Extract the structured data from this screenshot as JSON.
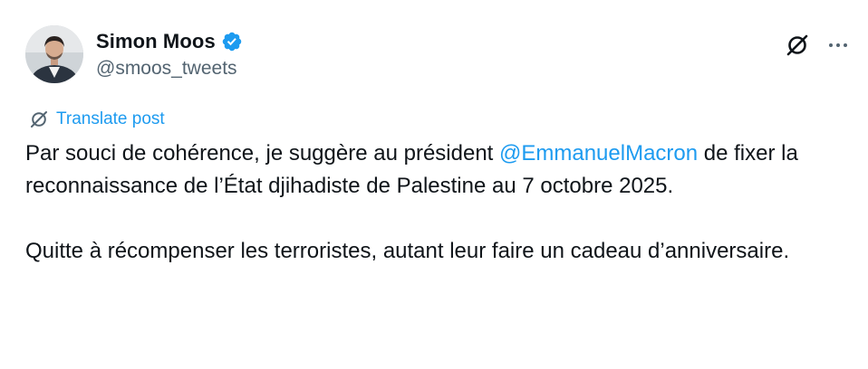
{
  "author": {
    "display_name": "Simon Moos",
    "handle": "@smoos_tweets",
    "verified": true,
    "verified_color": "#1d9bf0"
  },
  "actions": {
    "grok_icon": "grok-icon",
    "more_icon": "more-icon"
  },
  "translate": {
    "label": "Translate post",
    "icon": "grok-icon"
  },
  "tweet": {
    "p1_before": "Par souci de cohérence, je suggère au président ",
    "p1_mention": "@EmmanuelMacron",
    "p1_after": " de fixer la reconnaissance de l’État djihadiste de Palestine au 7 octobre 2025.",
    "p2": "Quitte à récompenser les terroristes, autant leur faire un cadeau d’anniversaire."
  },
  "colors": {
    "text": "#0f1419",
    "secondary": "#536471",
    "accent": "#1d9bf0"
  }
}
